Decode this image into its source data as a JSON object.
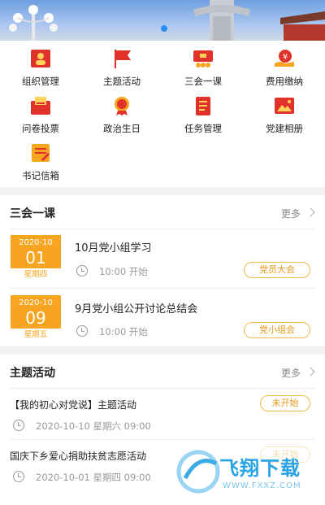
{
  "grid": {
    "items": [
      {
        "label": "组织管理",
        "icon": "org-icon"
      },
      {
        "label": "主题活动",
        "icon": "flag-icon"
      },
      {
        "label": "三会一课",
        "icon": "meeting-icon"
      },
      {
        "label": "费用缴纳",
        "icon": "payment-icon"
      },
      {
        "label": "问卷投票",
        "icon": "vote-icon"
      },
      {
        "label": "政治生日",
        "icon": "badge-icon"
      },
      {
        "label": "任务管理",
        "icon": "task-icon"
      },
      {
        "label": "党建相册",
        "icon": "album-icon"
      },
      {
        "label": "书记信箱",
        "icon": "mailbox-icon"
      }
    ]
  },
  "meetings": {
    "title": "三会一课",
    "more": "更多",
    "items": [
      {
        "ym": "2020-10",
        "day": "01",
        "weekday": "星期四",
        "title": "10月党小组学习",
        "time": "10:00 开始",
        "tag": "党员大会"
      },
      {
        "ym": "2020-10",
        "day": "09",
        "weekday": "星期五",
        "title": "9月党小组公开讨论总结会",
        "time": "10:00 开始",
        "tag": "党小组会"
      }
    ]
  },
  "activities": {
    "title": "主题活动",
    "more": "更多",
    "items": [
      {
        "title": "【我的初心对党说】主题活动",
        "time": "2020-10-10 星期六 09:00",
        "status": "未开始"
      },
      {
        "title": "国庆下乡爱心捐助扶贫志愿活动",
        "time": "2020-10-01 星期四 09:00",
        "status": "未开始"
      }
    ]
  },
  "watermark": {
    "text": "飞翔下载",
    "url": "WWW.FXXZ.COM"
  },
  "colors": {
    "accent": "#f7a521",
    "brand_red": "#e0322b",
    "link_blue": "#2b8cf7"
  }
}
